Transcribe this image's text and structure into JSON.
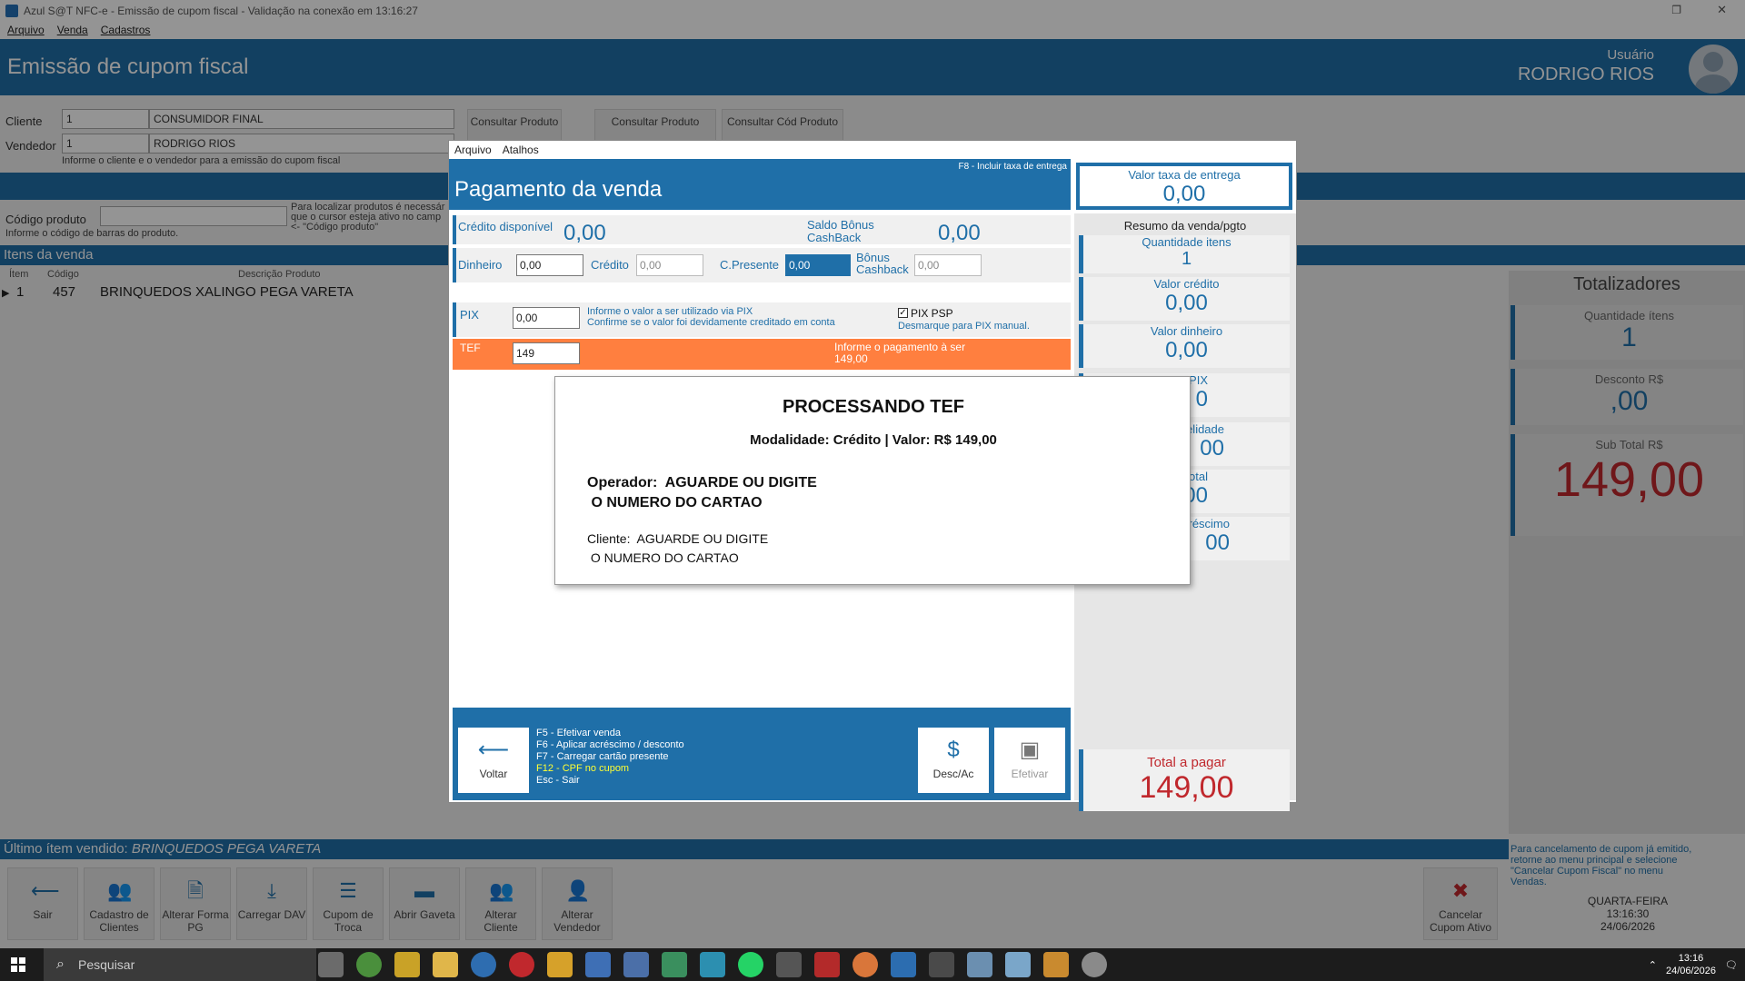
{
  "window": {
    "title": "Azul S@T NFC-e - Emissão de cupom fiscal - Validação na conexão em 13:16:27",
    "menu": [
      "Arquivo",
      "Venda",
      "Cadastros"
    ]
  },
  "header": {
    "title": "Emissão de cupom fiscal",
    "user_label": "Usuário",
    "user_name": "RODRIGO RIOS"
  },
  "form": {
    "cliente_label": "Cliente",
    "cliente_code": "1",
    "cliente_name": "CONSUMIDOR FINAL",
    "vendedor_label": "Vendedor",
    "vendedor_code": "1",
    "vendedor_name": "RODRIGO RIOS",
    "hint": "Informe o cliente e o vendedor para a emissão do cupom fiscal",
    "codigo_label": "Código produto",
    "codigo_hint": "Informe o código de barras do produto.",
    "codigo_side_hint_1": "Para localizar produtos é necessár",
    "codigo_side_hint_2": "que o cursor esteja ativo no camp",
    "codigo_side_hint_3": "<- \"Código produto\""
  },
  "top_buttons": [
    {
      "label": "Consultar Produto"
    },
    {
      "label": "Consultar Produto"
    },
    {
      "label": "Consultar Cód Produto"
    }
  ],
  "items": {
    "title": "Itens da venda",
    "col_item": "Ítem",
    "col_code": "Código",
    "col_desc": "Descrição Produto",
    "rows": [
      {
        "item": "1",
        "code": "457",
        "desc": "BRINQUEDOS XALINGO PEGA VARETA"
      }
    ]
  },
  "totalizers": {
    "title": "Totalizadores",
    "qty_label": "Quantidade ítens",
    "qty_value": "1",
    "desc_label": "Desconto R$",
    "desc_value": ",00",
    "subtotal_label": "Sub Total R$",
    "subtotal_value": "149,00"
  },
  "cancel_note": "Para cancelamento de cupom já emitido, retorne ao menu principal e selecione \"Cancelar Cupom Fiscal\" no menu Vendas.",
  "datetime": {
    "weekday": "QUARTA-FEIRA",
    "time": "13:16:30",
    "date": "24/06/2026"
  },
  "last_item": {
    "label": "Último ítem vendido:",
    "value": "BRINQUEDOS PEGA VARETA"
  },
  "footer_buttons": [
    {
      "label": "Sair",
      "icon": "arrow-left-icon"
    },
    {
      "label": "Cadastro de Clientes",
      "icon": "users-icon"
    },
    {
      "label": "Alterar Forma PG",
      "icon": "document-icon"
    },
    {
      "label": "Carregar DAV",
      "icon": "download-icon"
    },
    {
      "label": "Cupom de Troca",
      "icon": "list-icon"
    },
    {
      "label": "Abrir Gaveta",
      "icon": "folder-icon"
    },
    {
      "label": "Alterar Cliente",
      "icon": "users-icon"
    },
    {
      "label": "Alterar Vendedor",
      "icon": "user-icon"
    }
  ],
  "cancel_button": {
    "label": "Cancelar Cupom Ativo",
    "icon": "cancel-icon"
  },
  "modal": {
    "menu": [
      "Arquivo",
      "Atalhos"
    ],
    "title": "Pagamento da venda",
    "f8_hint": "F8 - Incluir taxa de entrega",
    "delivery_label": "Valor taxa de entrega",
    "delivery_value": "0,00",
    "credito_disp_label": "Crédito disponível",
    "credito_disp_value": "0,00",
    "bonus_label": "Saldo Bônus CashBack",
    "bonus_value": "0,00",
    "dinheiro_label": "Dinheiro",
    "dinheiro_value": "0,00",
    "credito_label": "Crédito",
    "credito_value": "0,00",
    "cpresente_label": "C.Presente",
    "cpresente_value": "0,00",
    "bonus_cash_label": "Bônus Cashback",
    "bonus_cash_value": "0,00",
    "pix_label": "PIX",
    "pix_value": "0,00",
    "pix_info_1": "Informe o valor a ser utilizado via PIX",
    "pix_info_2": "Confirme se o valor foi devidamente creditado em conta",
    "pix_psp_label": "PIX PSP",
    "pix_psp_checked": true,
    "pix_psp_hint": "Desmarque para PIX manual.",
    "tef_label": "TEF",
    "tef_value": "149",
    "tef_info_1": "Informe o pagamento à ser",
    "tef_info_2": "149,00",
    "summary_title": "Resumo da venda/pgto",
    "sum_qty_label": "Quantidade itens",
    "sum_qty_value": "1",
    "sum_credit_label": "Valor crédito",
    "sum_credit_value": "0,00",
    "sum_cash_label": "Valor dinheiro",
    "sum_cash_value": "0,00",
    "sum_pix_label": "PIX",
    "sum_pix_value": "0",
    "sum_fid_label": "delidade",
    "sum_fid_value": "00",
    "sum_total_label": "otal",
    "sum_total_value": "00",
    "sum_acr_label": "créscimo",
    "sum_acr_value": "00",
    "total_label": "Total a pagar",
    "total_value": "149,00",
    "shortcuts": [
      "F5 - Efetivar venda",
      "F6 - Aplicar acréscimo / desconto",
      "F7 - Carregar cartão presente",
      "F12 - CPF no cupom",
      "Esc - Sair"
    ],
    "btn_back": "Voltar",
    "btn_desc": "Desc/Ac",
    "btn_efetivar": "Efetivar"
  },
  "tef_popup": {
    "title": "PROCESSANDO TEF",
    "modalidade": "Modalidade: Crédito   |   Valor: R$ 149,00",
    "operador": "Operador:  AGUARDE OU DIGITE\n O NUMERO DO CARTAO",
    "cliente": "Cliente:  AGUARDE OU DIGITE\n O NUMERO DO CARTAO"
  },
  "taskbar": {
    "search_placeholder": "Pesquisar",
    "time": "13:16",
    "date": "24/06/2026"
  }
}
